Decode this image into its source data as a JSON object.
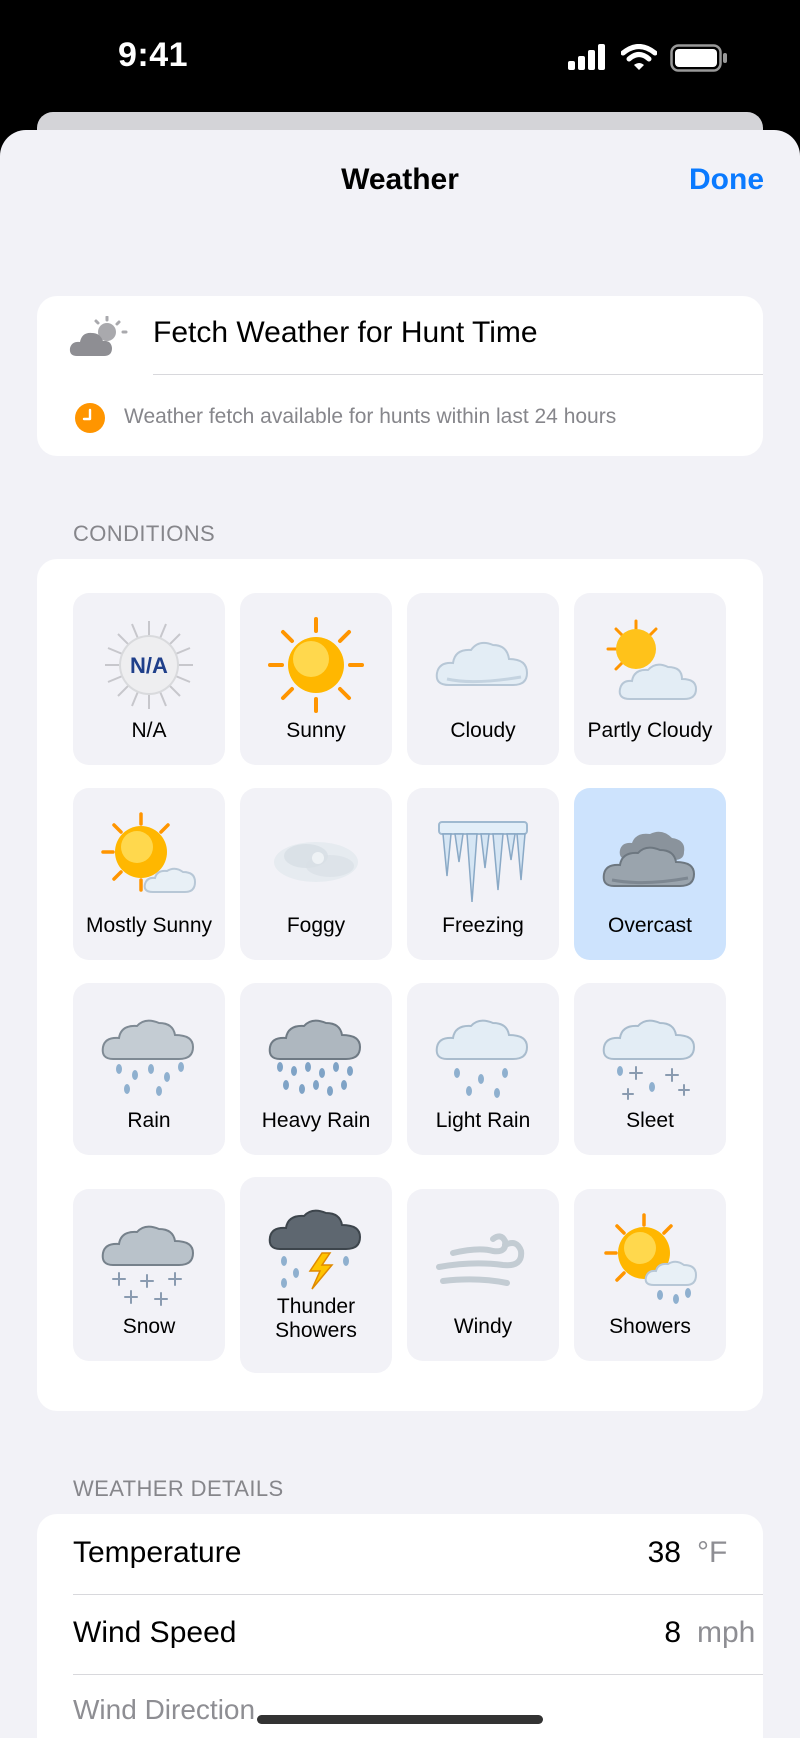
{
  "status_bar": {
    "time": "9:41"
  },
  "nav": {
    "title": "Weather",
    "done_label": "Done"
  },
  "fetch": {
    "label": "Fetch Weather for Hunt Time",
    "note": "Weather fetch available for hunts within last 24 hours"
  },
  "conditions": {
    "header": "CONDITIONS",
    "selected": "Overcast",
    "items": [
      {
        "label": "N/A",
        "icon": "na-icon"
      },
      {
        "label": "Sunny",
        "icon": "sunny-icon"
      },
      {
        "label": "Cloudy",
        "icon": "cloudy-icon"
      },
      {
        "label": "Partly Cloudy",
        "icon": "partly-cloudy-icon"
      },
      {
        "label": "Mostly Sunny",
        "icon": "mostly-sunny-icon"
      },
      {
        "label": "Foggy",
        "icon": "foggy-icon"
      },
      {
        "label": "Freezing",
        "icon": "freezing-icon"
      },
      {
        "label": "Overcast",
        "icon": "overcast-icon"
      },
      {
        "label": "Rain",
        "icon": "rain-icon"
      },
      {
        "label": "Heavy Rain",
        "icon": "heavy-rain-icon"
      },
      {
        "label": "Light Rain",
        "icon": "light-rain-icon"
      },
      {
        "label": "Sleet",
        "icon": "sleet-icon"
      },
      {
        "label": "Snow",
        "icon": "snow-icon"
      },
      {
        "label": "Thunder\nShowers",
        "icon": "thunder-showers-icon"
      },
      {
        "label": "Windy",
        "icon": "windy-icon"
      },
      {
        "label": "Showers",
        "icon": "showers-icon"
      }
    ]
  },
  "details": {
    "header": "WEATHER DETAILS",
    "rows": [
      {
        "name": "Temperature",
        "value": "38",
        "unit": "°F"
      },
      {
        "name": "Wind Speed",
        "value": "8",
        "unit": "mph"
      },
      {
        "name": "Wind Direction"
      }
    ]
  },
  "colors": {
    "accent": "#0A7AFF",
    "selected_tile": "#CDE3FD",
    "clock_orange": "#FF9500"
  }
}
